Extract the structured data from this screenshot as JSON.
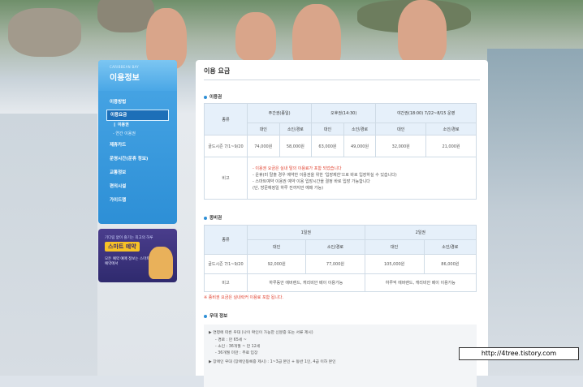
{
  "sidebar": {
    "eyebrow": "CARIBBEAN BAY",
    "title": "이용정보",
    "items": [
      {
        "label": "이용방법"
      },
      {
        "label": "이용요금"
      },
      {
        "label": "제휴카드"
      },
      {
        "label": "운영시간(운휴 정보)"
      },
      {
        "label": "교통정보"
      },
      {
        "label": "편의시설"
      },
      {
        "label": "가이드맵"
      }
    ],
    "subitems": [
      {
        "label": "이용권"
      },
      {
        "label": "- 연간 이용권"
      }
    ]
  },
  "promo": {
    "line1": "기다림 없이 즐기는 최고의 하루",
    "badge": "스마트 예약",
    "line2": "모든 예약 예매 정보는 스마트예약에서"
  },
  "main": {
    "page_title": "이용 요금",
    "section1": "이용권",
    "table1": {
      "col_type": "종류",
      "groups": [
        "주간권(종일)",
        "오후권(14:30)",
        "야간권(18:00) 7/22~8/15 운영"
      ],
      "sub_adult": "대인",
      "sub_child": "소인/경로",
      "row_label": "골드시즌 7/1~9/20",
      "values": [
        "74,000원",
        "58,000원",
        "63,000원",
        "49,000원",
        "32,000원",
        "21,000원"
      ],
      "note_label": "비고",
      "notes": [
        "- 이용권 요금은 실내 탈의 이용료가 포함 되었습니다",
        "- 운휴(미 탈출 경우 예약한 이용권을 위한 '입장제한'으로 바로 입장하실 수 있습니다)",
        "- 스마트예약 이용권 예약 이용 입장시간을 결정 바로 입장 가능합니다",
        "(단, 방문예정일 하루 전까지만 예매 가능)"
      ]
    },
    "section2": "종비권",
    "table2": {
      "col_type": "종류",
      "groups": [
        "1일권",
        "2일권"
      ],
      "sub_adult": "대인",
      "sub_child": "소인/경로",
      "row_label": "골드시즌 7/1~9/20",
      "values": [
        "92,000원",
        "77,000원",
        "105,000원",
        "86,000원"
      ],
      "note_label": "비고",
      "notes": [
        "하루동안 에버랜드, 캐리비안 베이 이용가능",
        "하루씩 에버랜드, 캐리비안 베이 이용가능"
      ]
    },
    "footnote": "※ 종비권 요금은 실내락커 이용료 포함 됩니다.",
    "section3": "우대 정보",
    "info": [
      "▶ 연령에 따른 우대 (나이 확인이 가능한 신분증 또는 서류 제시)",
      "- 경로 : 만 65세 ~",
      "- 소인 : 36개월 ~ 만 12세",
      "- 36개월 미만 : 무료 입장",
      "▶ 장애인 우대 (장애인등록증 제시) : 1~3급 본인 + 동반 1인, 4급 이하 본인"
    ]
  },
  "watermark": "http://4tree.tistory.com"
}
